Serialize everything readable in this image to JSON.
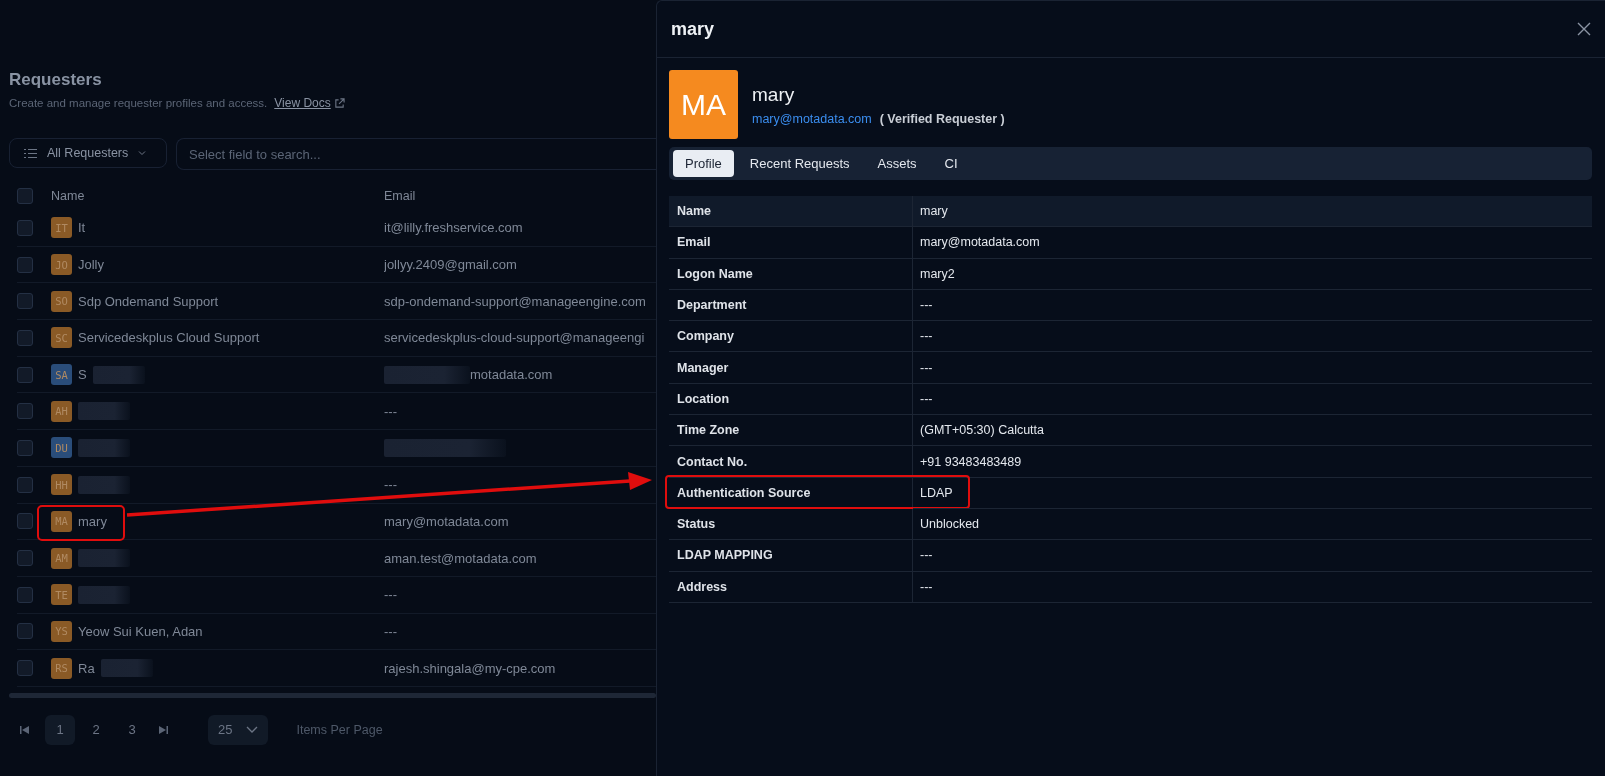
{
  "page": {
    "title": "Requesters",
    "subtitle": "Create and manage requester profiles and access.",
    "docs_link": "View Docs"
  },
  "toolbar": {
    "filter": "All Requesters",
    "search_placeholder": "Select field to search..."
  },
  "table": {
    "select_all_checked": false,
    "columns": [
      "Name",
      "Email"
    ],
    "rows": [
      {
        "checked": false,
        "initials": "IT",
        "color": "#8a5a26",
        "name": "It",
        "email": "it@lilly.freshservice.com",
        "highlighted": false
      },
      {
        "checked": false,
        "initials": "JO",
        "color": "#8a5a26",
        "name": "Jolly",
        "email": "jollyy.2409@gmail.com",
        "highlighted": false
      },
      {
        "checked": false,
        "initials": "SO",
        "color": "#8a5a26",
        "name": "Sdp Ondemand Support",
        "email": "sdp-ondemand-support@manageengine.com",
        "highlighted": false
      },
      {
        "checked": false,
        "initials": "SC",
        "color": "#8a5a26",
        "name": "Servicedeskplus Cloud Support",
        "email": "servicedeskplus-cloud-support@manageengi",
        "highlighted": false
      },
      {
        "checked": false,
        "initials": "SA",
        "color": "#2a4d7a",
        "name": "S",
        "name_redacted": true,
        "email": "motadata.com",
        "email_redacted": true,
        "highlighted": false
      },
      {
        "checked": false,
        "initials": "AH",
        "color": "#8a5a26",
        "name_redacted": true,
        "email": "---",
        "highlighted": false
      },
      {
        "checked": false,
        "initials": "DU",
        "color": "#2a4d7a",
        "name_redacted": true,
        "email_redacted": true,
        "highlighted": false
      },
      {
        "checked": false,
        "initials": "HH",
        "color": "#8a5a26",
        "name_redacted": true,
        "email": "---",
        "highlighted": false
      },
      {
        "checked": false,
        "initials": "MA",
        "color": "#8a5a26",
        "name": "mary",
        "email": "mary@motadata.com",
        "highlighted": true
      },
      {
        "checked": false,
        "initials": "AM",
        "color": "#8a5a26",
        "name_redacted": true,
        "email": "aman.test@motadata.com",
        "highlighted": false
      },
      {
        "checked": false,
        "initials": "TE",
        "color": "#8a5a26",
        "name_redacted": true,
        "email": "---",
        "highlighted": false
      },
      {
        "checked": false,
        "initials": "YS",
        "color": "#8a5a26",
        "name": "Yeow Sui Kuen, Adan",
        "email": "---",
        "highlighted": false
      },
      {
        "checked": false,
        "initials": "RS",
        "color": "#8a5a26",
        "name": "Ra",
        "name_redacted": true,
        "email": "rajesh.shingala@my-cpe.com",
        "highlighted": false
      }
    ]
  },
  "pagination": {
    "pages": [
      {
        "label": "1",
        "selected": true
      },
      {
        "label": "2",
        "selected": false
      },
      {
        "label": "3",
        "selected": false
      }
    ],
    "page_size": "25",
    "page_size_label": "Items Per Page"
  },
  "drawer": {
    "title": "mary",
    "initials": "MA",
    "name": "mary",
    "email": "mary@motadata.com",
    "badge": "( Verified Requester )",
    "tabs": [
      {
        "label": "Profile",
        "selected": true
      },
      {
        "label": "Recent Requests",
        "selected": false
      },
      {
        "label": "Assets",
        "selected": false
      },
      {
        "label": "CI",
        "selected": false
      }
    ],
    "fields": [
      {
        "label": "Name",
        "value": "mary",
        "highlighted": false
      },
      {
        "label": "Email",
        "value": "mary@motadata.com",
        "highlighted": false
      },
      {
        "label": "Logon Name",
        "value": "mary2",
        "highlighted": false
      },
      {
        "label": "Department",
        "value": "---",
        "highlighted": false
      },
      {
        "label": "Company",
        "value": "---",
        "highlighted": false
      },
      {
        "label": "Manager",
        "value": "---",
        "highlighted": false
      },
      {
        "label": "Location",
        "value": "---",
        "highlighted": false
      },
      {
        "label": "Time Zone",
        "value": "(GMT+05:30) Calcutta",
        "highlighted": false
      },
      {
        "label": "Contact No.",
        "value": "+91 93483483489",
        "highlighted": false
      },
      {
        "label": "Authentication Source",
        "value": "LDAP",
        "highlighted": true
      },
      {
        "label": "Status",
        "value": "Unblocked",
        "highlighted": false
      },
      {
        "label": "LDAP MAPPING",
        "value": "---",
        "highlighted": false
      },
      {
        "label": "Address",
        "value": "---",
        "highlighted": false
      }
    ]
  }
}
